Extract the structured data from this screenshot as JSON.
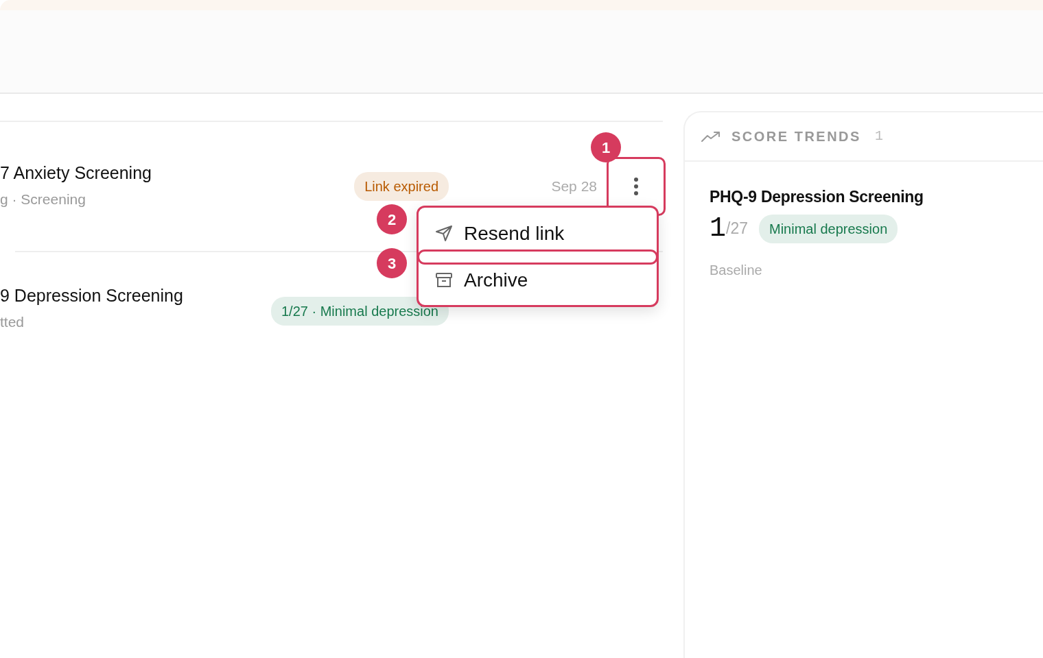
{
  "rows": [
    {
      "kind": "assessment",
      "title": "7 Anxiety Screening",
      "subtitle": "g · Screening",
      "badge": "Link expired",
      "color": "#b85a00",
      "date": "Sep 28"
    },
    {
      "kind": "divider"
    },
    {
      "kind": "assessment",
      "title": "9 Depression Screening",
      "subtitle": "tted",
      "badge": "1/27 · Minimal depression",
      "color": "#17794d"
    }
  ],
  "menu": {
    "items": [
      {
        "kind": "send",
        "label": "Resend link"
      },
      {
        "kind": "archive",
        "label": "Archive"
      }
    ]
  },
  "annotations": [
    {
      "number": "1"
    },
    {
      "number": "2"
    },
    {
      "number": "3"
    }
  ],
  "trends": {
    "title": "SCORE TRENDS",
    "count": "1",
    "items": [
      {
        "title": "PHQ-9 Depression Screening",
        "score": "1",
        "max": "/27",
        "badge": "Minimal depression",
        "color": "#17794d",
        "note": "Baseline"
      }
    ]
  }
}
